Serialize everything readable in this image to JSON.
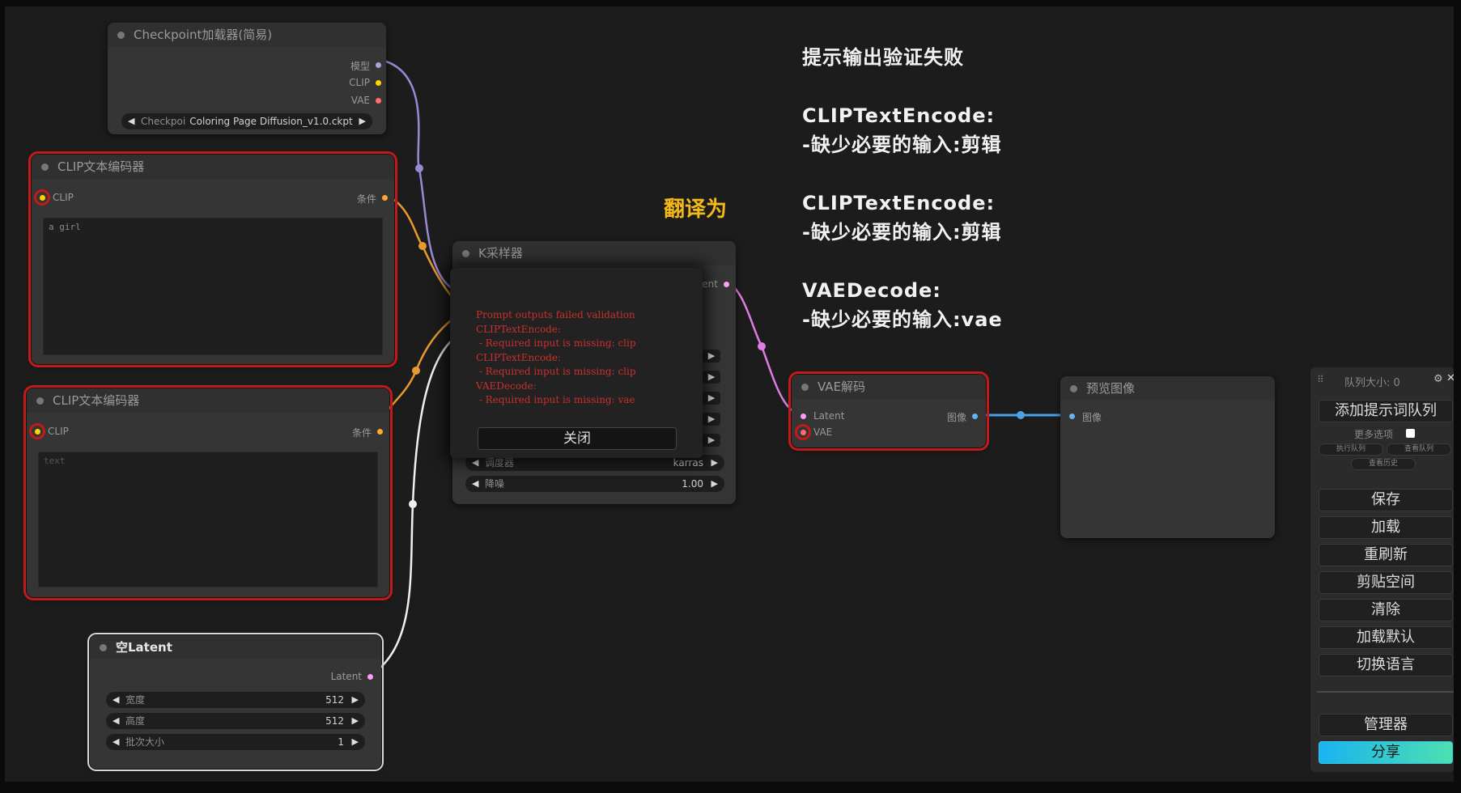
{
  "nodes": {
    "checkpoint": {
      "title": "Checkpoint加载器(简易)",
      "outputs": [
        "模型",
        "CLIP",
        "VAE"
      ],
      "ckpt_name": "Coloring Page Diffusion_v1.0.ckpt",
      "ckpt_label": "Checkpoi"
    },
    "clip1": {
      "title": "CLIP文本编码器",
      "input": "CLIP",
      "output": "条件",
      "text": "a girl"
    },
    "clip2": {
      "title": "CLIP文本编码器",
      "input": "CLIP",
      "output": "条件",
      "text": "text"
    },
    "ksampler": {
      "title": "K采样器",
      "output_partial": "tent",
      "scheduler_label": "调度器",
      "scheduler_value": "karras",
      "denoise_label": "降噪",
      "denoise_value": "1.00"
    },
    "vae_decode": {
      "title": "VAE解码",
      "input_latent": "Latent",
      "input_vae": "VAE",
      "output": "图像"
    },
    "preview": {
      "title": "预览图像",
      "input": "图像"
    },
    "empty_latent": {
      "title": "空Latent",
      "output": "Latent",
      "width_label": "宽度",
      "width_value": "512",
      "height_label": "高度",
      "height_value": "512",
      "batch_label": "批次大小",
      "batch_value": "1"
    }
  },
  "dialog": {
    "message": "Prompt outputs failed validation\nCLIPTextEncode:\n - Required input is missing: clip\nCLIPTextEncode:\n - Required input is missing: clip\nVAEDecode:\n - Required input is missing: vae",
    "close_label": "关闭"
  },
  "annotation": {
    "line1": "提示输出验证失败",
    "line2": "CLIPTextEncode:",
    "line3": "-缺少必要的输入:剪辑",
    "line4": "CLIPTextEncode:",
    "line5": "-缺少必要的输入:剪辑",
    "line6": "VAEDecode:",
    "line7": "-缺少必要的输入:vae",
    "translate_label": "翻译为"
  },
  "panel": {
    "queue_size": "队列大小: 0",
    "queue_prompt": "添加提示词队列",
    "more_options": "更多选项",
    "small_btn1": "执行队列",
    "small_btn2": "查看队列",
    "small_btn3": "查看历史",
    "save": "保存",
    "load": "加载",
    "refresh": "重刷新",
    "clipspace": "剪贴空间",
    "clear": "清除",
    "load_default": "加载默认",
    "switch_lang": "切换语言",
    "manager": "管理器",
    "share": "分享"
  },
  "colors": {
    "model": "#b39ddb",
    "clip": "#ffd500",
    "vae": "#ff6e6e",
    "conditioning": "#ffa931",
    "latent": "#ff9cf9",
    "image": "#64b5f6",
    "error": "#c21a1a",
    "annotation_highlight": "#f3b81a"
  }
}
